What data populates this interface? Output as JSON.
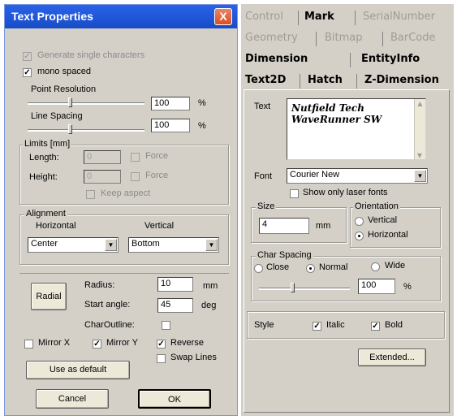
{
  "dialog": {
    "title": "Text Properties",
    "close_glyph": "X",
    "generate_single": "Generate single characters",
    "mono_spaced": "mono spaced",
    "point_resolution": {
      "label": "Point Resolution",
      "value": "100",
      "unit": "%",
      "level": 0.35
    },
    "line_spacing": {
      "label": "Line Spacing",
      "value": "100",
      "unit": "%",
      "level": 0.35
    },
    "limits": {
      "title": "Limits [mm]",
      "length_label": "Length:",
      "length_value": "0",
      "height_label": "Height:",
      "height_value": "0",
      "force": "Force",
      "keep_aspect": "Keep aspect"
    },
    "alignment": {
      "title": "Alignment",
      "horizontal_label": "Horizontal",
      "vertical_label": "Vertical",
      "horizontal_value": "Center",
      "vertical_value": "Bottom"
    },
    "radial": {
      "button": "Radial",
      "radius_label": "Radius:",
      "radius_value": "10",
      "radius_unit": "mm",
      "start_label": "Start angle:",
      "start_value": "45",
      "start_unit": "deg",
      "char_outline": "CharOutline:"
    },
    "mirror_x": "Mirror X",
    "mirror_y": "Mirror Y",
    "reverse": "Reverse",
    "swap_lines": "Swap Lines",
    "use_default": "Use as default",
    "cancel": "Cancel",
    "ok": "OK"
  },
  "panel": {
    "tabs": {
      "control": "Control",
      "mark": "Mark",
      "serial": "SerialNumber",
      "geometry": "Geometry",
      "bitmap": "Bitmap",
      "barcode": "BarCode",
      "dimension": "Dimension",
      "entityinfo": "EntityInfo",
      "text2d": "Text2D",
      "hatch": "Hatch",
      "zdimension": "Z-Dimension"
    },
    "text_label": "Text",
    "text_line1": "Nutfield Tech",
    "text_line2": "WaveRunner SW",
    "font_label": "Font",
    "font_value": "Courier New",
    "only_laser": "Show only laser fonts",
    "size_title": "Size",
    "size_value": "4",
    "size_unit": "mm",
    "orientation_title": "Orientation",
    "vertical": "Vertical",
    "horizontal": "Horizontal",
    "char_spacing_title": "Char Spacing",
    "close": "Close",
    "normal": "Normal",
    "wide": "Wide",
    "spacing_value": "100",
    "spacing_unit": "%",
    "spacing_level": 0.35,
    "style_label": "Style",
    "italic": "Italic",
    "bold": "Bold",
    "extended": "Extended..."
  },
  "icons": {
    "check": "checkmark-icon",
    "arrow": "dropdown-arrow-icon",
    "close": "close-icon"
  }
}
